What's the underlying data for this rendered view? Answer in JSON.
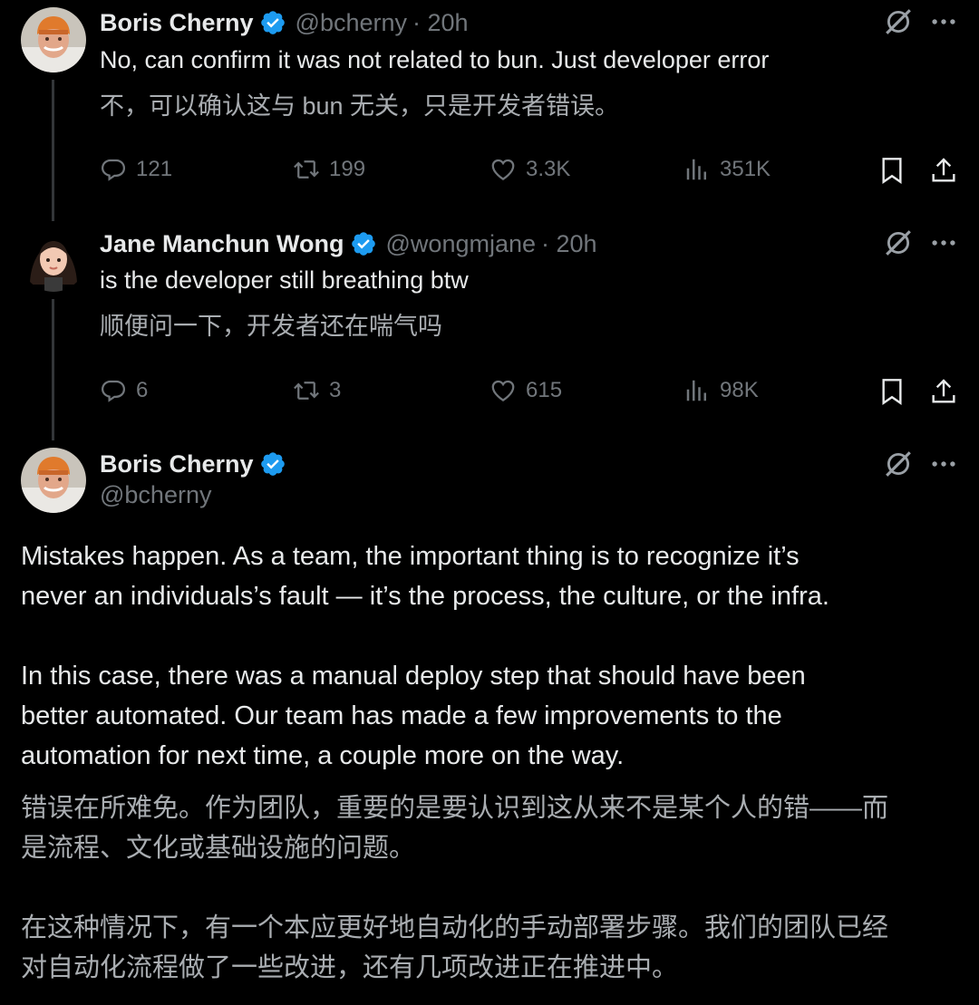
{
  "tweets": [
    {
      "name": "Boris Cherny",
      "handle": "@bcherny",
      "time": "· 20h",
      "text": "No, can confirm it was not related to bun. Just developer error",
      "translation": "不，可以确认这与 bun 无关，只是开发者错误。",
      "replies": "121",
      "retweets": "199",
      "likes": "3.3K",
      "views": "351K"
    },
    {
      "name": "Jane Manchun Wong",
      "handle": "@wongmjane",
      "time": "· 20h",
      "text": "is the developer still breathing btw",
      "translation": "顺便问一下，开发者还在喘气吗",
      "replies": "6",
      "retweets": "3",
      "likes": "615",
      "views": "98K"
    }
  ],
  "main": {
    "name": "Boris Cherny",
    "handle": "@bcherny",
    "paragraph1": [
      "Mistakes happen. As a team, the important thing is to recognize it’s",
      "never an individuals’s fault — it’s the process, the culture, or the infra."
    ],
    "paragraph2": [
      "In this case, there was a manual deploy step that should have been",
      "better automated. Our team has made a few improvements to the",
      "automation for next time, a couple more on the way."
    ],
    "translation1": [
      "错误在所难免。作为团队，重要的是要认识到这从来不是某个人的错——而",
      "是流程、文化或基础设施的问题。"
    ],
    "translation2": [
      "在这种情况下，有一个本应更好地自动化的手动部署步骤。我们的团队已经",
      "对自动化流程做了一些改进，还有几项改进正在推进中。"
    ]
  },
  "colors": {
    "background": "#000000",
    "text": "#e7e9ea",
    "secondary": "#71767b",
    "verified": "#1d9bf0"
  }
}
